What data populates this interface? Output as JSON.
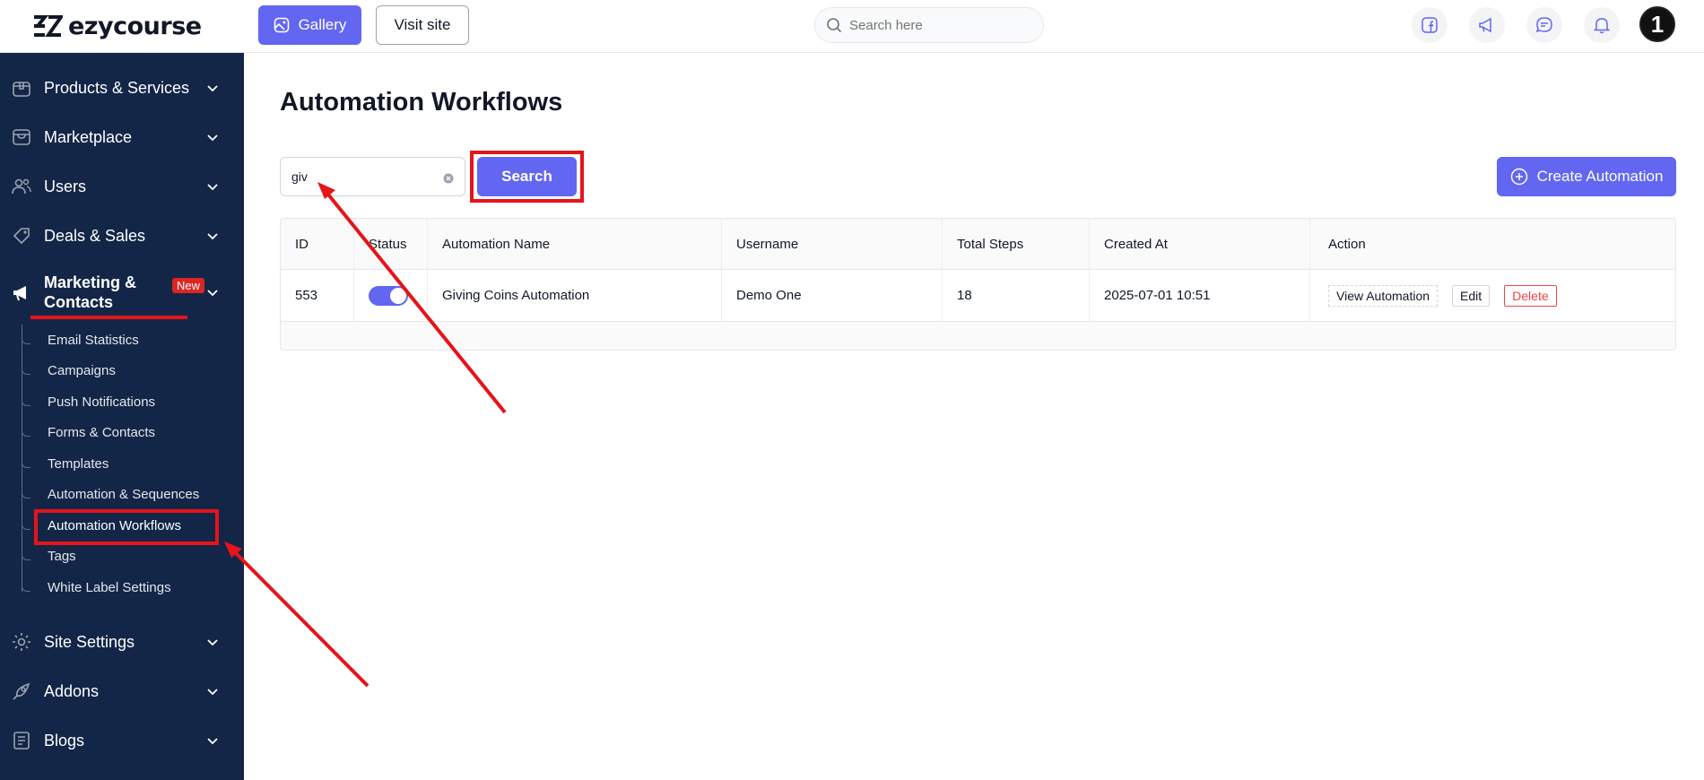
{
  "brand": {
    "name": "ezycourse"
  },
  "topbar": {
    "gallery_label": "Gallery",
    "visit_label": "Visit site",
    "search_placeholder": "Search here",
    "avatar_text": "1"
  },
  "sidebar": {
    "items": [
      {
        "label": "Products & Services"
      },
      {
        "label": "Marketplace"
      },
      {
        "label": "Users"
      },
      {
        "label": "Deals & Sales"
      },
      {
        "label": "Marketing &",
        "label2": "Contacts",
        "badge": "New"
      },
      {
        "label": "Site Settings"
      },
      {
        "label": "Addons"
      },
      {
        "label": "Blogs"
      }
    ],
    "sub_items": [
      {
        "label": "Email Statistics"
      },
      {
        "label": "Campaigns"
      },
      {
        "label": "Push Notifications"
      },
      {
        "label": "Forms & Contacts"
      },
      {
        "label": "Templates"
      },
      {
        "label": "Automation & Sequences"
      },
      {
        "label": "Automation Workflows"
      },
      {
        "label": "Tags"
      },
      {
        "label": "White Label Settings"
      }
    ]
  },
  "main": {
    "title": "Automation Workflows",
    "filter_value": "giv",
    "search_label": "Search",
    "create_label": "Create Automation",
    "table": {
      "headers": [
        "ID",
        "Status",
        "Automation Name",
        "Username",
        "Total Steps",
        "Created At",
        "Action"
      ],
      "rows": [
        {
          "id": "553",
          "status_on": true,
          "name": "Giving Coins Automation",
          "username": "Demo One",
          "steps": "18",
          "created": "2025-07-01 10:51",
          "actions": {
            "view": "View Automation",
            "edit": "Edit",
            "delete": "Delete"
          }
        }
      ]
    }
  },
  "colors": {
    "sidebar_bg": "#132647",
    "accent": "#6366f1",
    "annotation_red": "#e5141a",
    "danger": "#ef4444"
  }
}
